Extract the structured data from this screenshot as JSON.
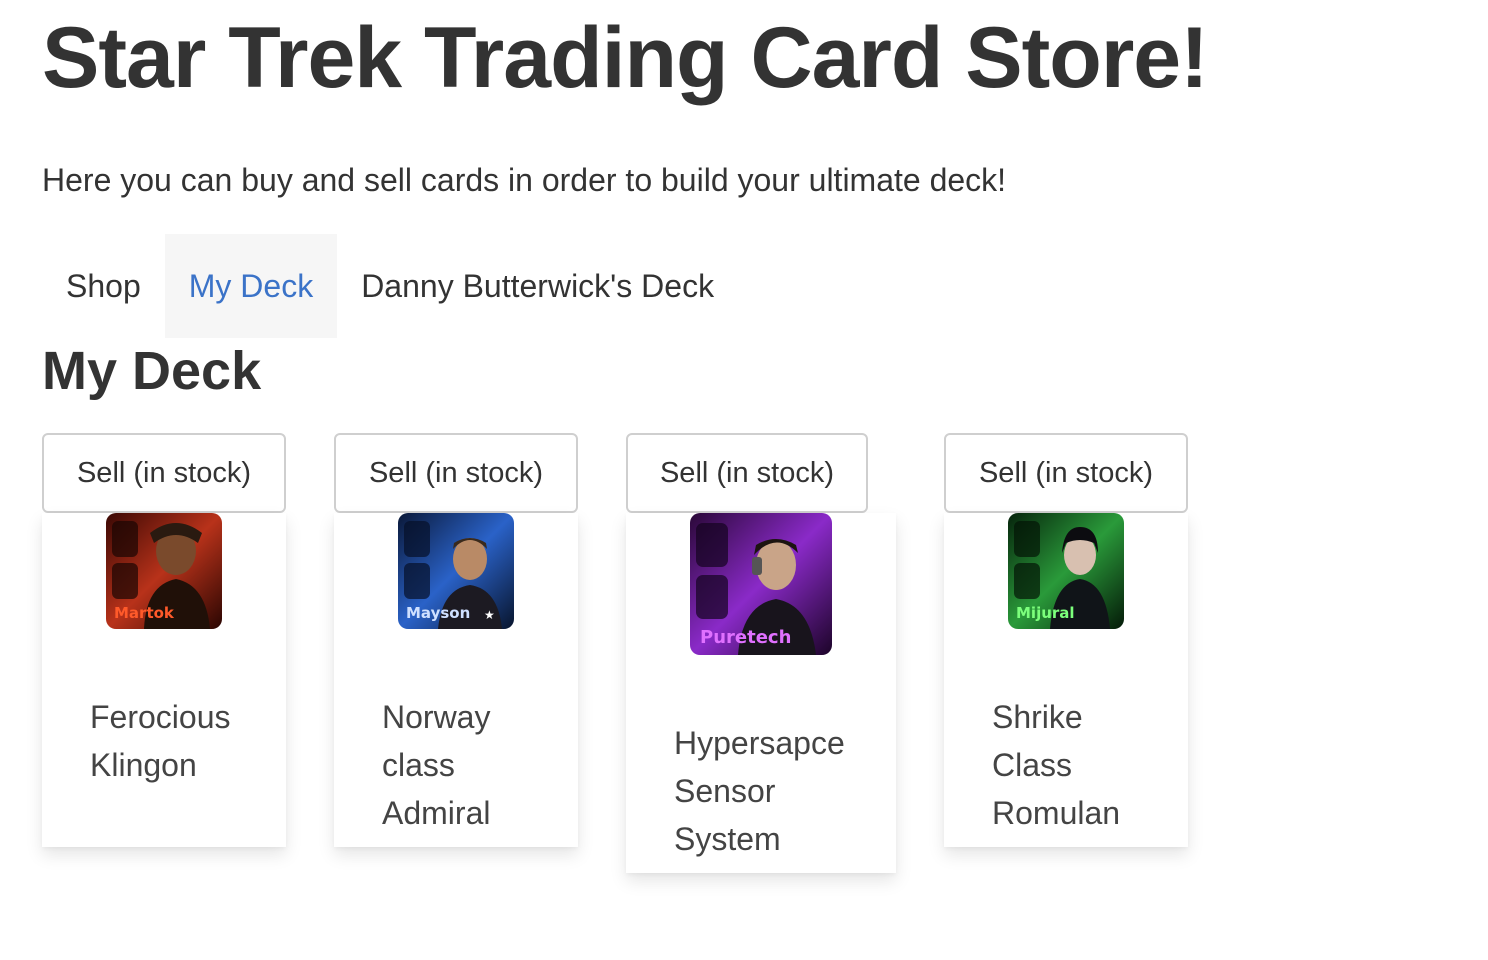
{
  "header": {
    "title": "Star Trek Trading Card Store!",
    "intro": "Here you can buy and sell cards in order to build your ultimate deck!"
  },
  "tabs": [
    {
      "label": "Shop",
      "active": false
    },
    {
      "label": "My Deck",
      "active": true
    },
    {
      "label": "Danny Butterwick's Deck",
      "active": false
    }
  ],
  "section": {
    "title": "My Deck"
  },
  "colors": {
    "active_tab_text": "#3b73c8",
    "active_tab_bg": "#f6f6f6",
    "text": "#333333"
  },
  "cards": [
    {
      "button_label": "Sell (in stock)",
      "image_caption": "Martok",
      "name_lines": [
        "Ferocious",
        "Klingon"
      ],
      "theme": "red",
      "icon": "klingon-portrait-icon"
    },
    {
      "button_label": "Sell (in stock)",
      "image_caption": "Mayson",
      "name_lines": [
        "Norway",
        "class",
        "Admiral"
      ],
      "theme": "blue",
      "icon": "admiral-portrait-icon"
    },
    {
      "button_label": "Sell (in stock)",
      "image_caption": "Puretech",
      "name_lines": [
        "Hypersapce",
        "Sensor",
        "System"
      ],
      "theme": "purple",
      "icon": "sensor-portrait-icon"
    },
    {
      "button_label": "Sell (in stock)",
      "image_caption": "Mijural",
      "name_lines": [
        "Shrike",
        "Class",
        "Romulan"
      ],
      "theme": "green",
      "icon": "romulan-portrait-icon"
    }
  ]
}
